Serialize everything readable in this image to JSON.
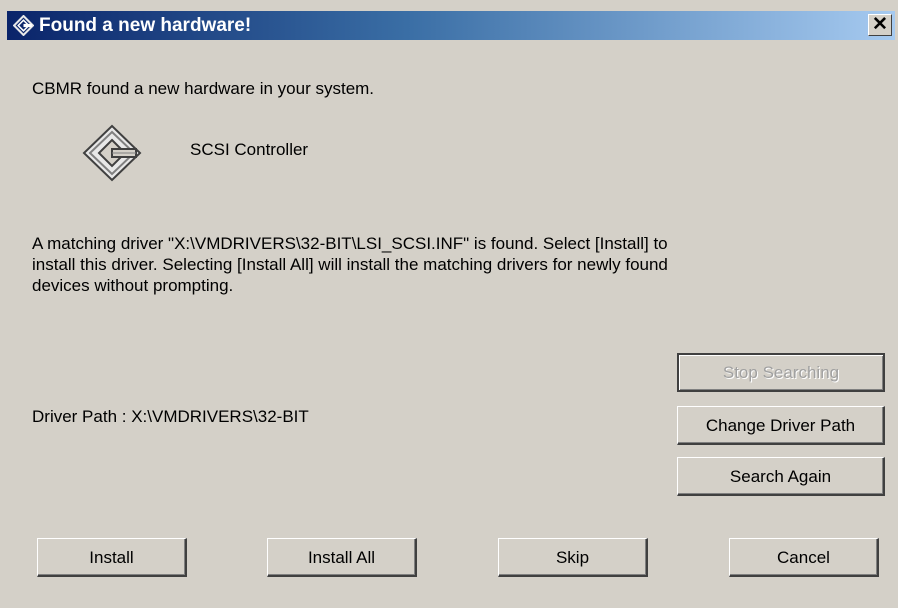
{
  "window": {
    "title": "Found a new hardware!",
    "close_label": "✕"
  },
  "message": {
    "intro": "CBMR found a new hardware in your system.",
    "device_name": "SCSI Controller",
    "driver_line1": "A matching driver \"X:\\VMDRIVERS\\32-BIT\\LSI_SCSI.INF\" is found. Select [Install] to",
    "driver_line2": "install this driver. Selecting [Install All] will install the matching drivers for newly found",
    "driver_line3": "devices without prompting.",
    "driver_path": "Driver Path : X:\\VMDRIVERS\\32-BIT"
  },
  "side_buttons": {
    "stop_searching": "Stop Searching",
    "change_driver_path": "Change Driver Path",
    "search_again": "Search Again"
  },
  "bottom_buttons": {
    "install": "Install",
    "install_all": "Install All",
    "skip": "Skip",
    "cancel": "Cancel"
  },
  "icons": {
    "title_icon": "cbmr-logo-icon",
    "device_icon": "hardware-device-icon"
  },
  "colors": {
    "titlebar_start": "#0a246a",
    "titlebar_end": "#a6caf0",
    "face": "#d4d0c8"
  }
}
